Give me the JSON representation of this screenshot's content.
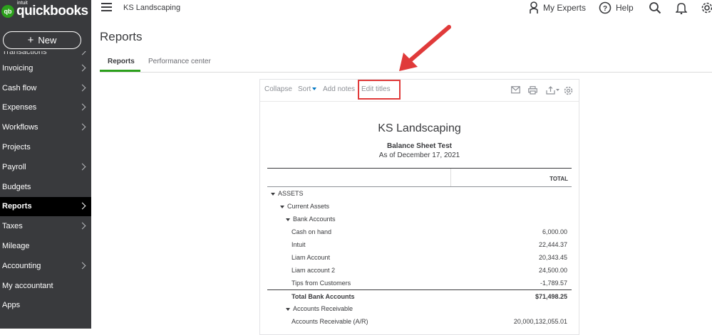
{
  "app": {
    "logo_small": "intuit",
    "logo_main": "quickbooks",
    "logo_badge": "qb",
    "new_label": "New",
    "company": "KS Landscaping"
  },
  "sidebar": {
    "items": [
      {
        "label": "Transactions",
        "chevron": true,
        "partial": true
      },
      {
        "label": "Invoicing",
        "chevron": true
      },
      {
        "label": "Cash flow",
        "chevron": true
      },
      {
        "label": "Expenses",
        "chevron": true
      },
      {
        "label": "Workflows",
        "chevron": true
      },
      {
        "label": "Projects",
        "chevron": false
      },
      {
        "label": "Payroll",
        "chevron": true
      },
      {
        "label": "Budgets",
        "chevron": false
      },
      {
        "label": "Reports",
        "chevron": true,
        "active": true
      },
      {
        "label": "Taxes",
        "chevron": true
      },
      {
        "label": "Mileage",
        "chevron": false
      },
      {
        "label": "Accounting",
        "chevron": true
      },
      {
        "label": "My accountant",
        "chevron": false
      },
      {
        "label": "Apps",
        "chevron": false
      }
    ]
  },
  "topbar": {
    "my_experts": "My Experts",
    "help": "Help",
    "icons": [
      "menu-icon",
      "person-icon",
      "help-icon",
      "search-icon",
      "bell-icon",
      "gear-icon"
    ]
  },
  "page": {
    "title": "Reports",
    "tabs": [
      {
        "label": "Reports",
        "active": true
      },
      {
        "label": "Performance center",
        "active": false
      }
    ]
  },
  "report": {
    "toolbar": {
      "collapse": "Collapse",
      "sort": "Sort",
      "add_notes": "Add notes",
      "edit_titles": "Edit titles",
      "icons": [
        "email-icon",
        "print-icon",
        "export-icon",
        "settings-icon"
      ]
    },
    "company": "KS Landscaping",
    "title": "Balance Sheet Test",
    "date": "As of December 17, 2021",
    "column_header": "TOTAL",
    "rows": [
      {
        "label": "ASSETS",
        "amount": "",
        "indent": 0,
        "expand": true
      },
      {
        "label": "Current Assets",
        "amount": "",
        "indent": 1,
        "expand": true
      },
      {
        "label": "Bank Accounts",
        "amount": "",
        "indent": 2,
        "expand": true
      },
      {
        "label": "Cash on hand",
        "amount": "6,000.00",
        "indent": 3
      },
      {
        "label": "Intuit",
        "amount": "22,444.37",
        "indent": 3
      },
      {
        "label": "Liam Account",
        "amount": "20,343.45",
        "indent": 3
      },
      {
        "label": "Liam account 2",
        "amount": "24,500.00",
        "indent": 3
      },
      {
        "label": "Tips from Customers",
        "amount": "-1,789.57",
        "indent": 3
      },
      {
        "label": "Total Bank Accounts",
        "amount": "$71,498.25",
        "indent": 3,
        "total": true
      },
      {
        "label": "Accounts Receivable",
        "amount": "",
        "indent": 2,
        "expand": true
      },
      {
        "label": "Accounts Receivable (A/R)",
        "amount": "20,000,132,055.01",
        "indent": 3
      }
    ]
  },
  "annotation": {
    "arrow_color": "#e03a3a",
    "highlight_color": "#e03a3a"
  },
  "colors": {
    "sidebar_bg": "#393a3d",
    "sidebar_active_bg": "#000000",
    "brand_green": "#2ca01c",
    "link_blue": "#0077c5"
  }
}
